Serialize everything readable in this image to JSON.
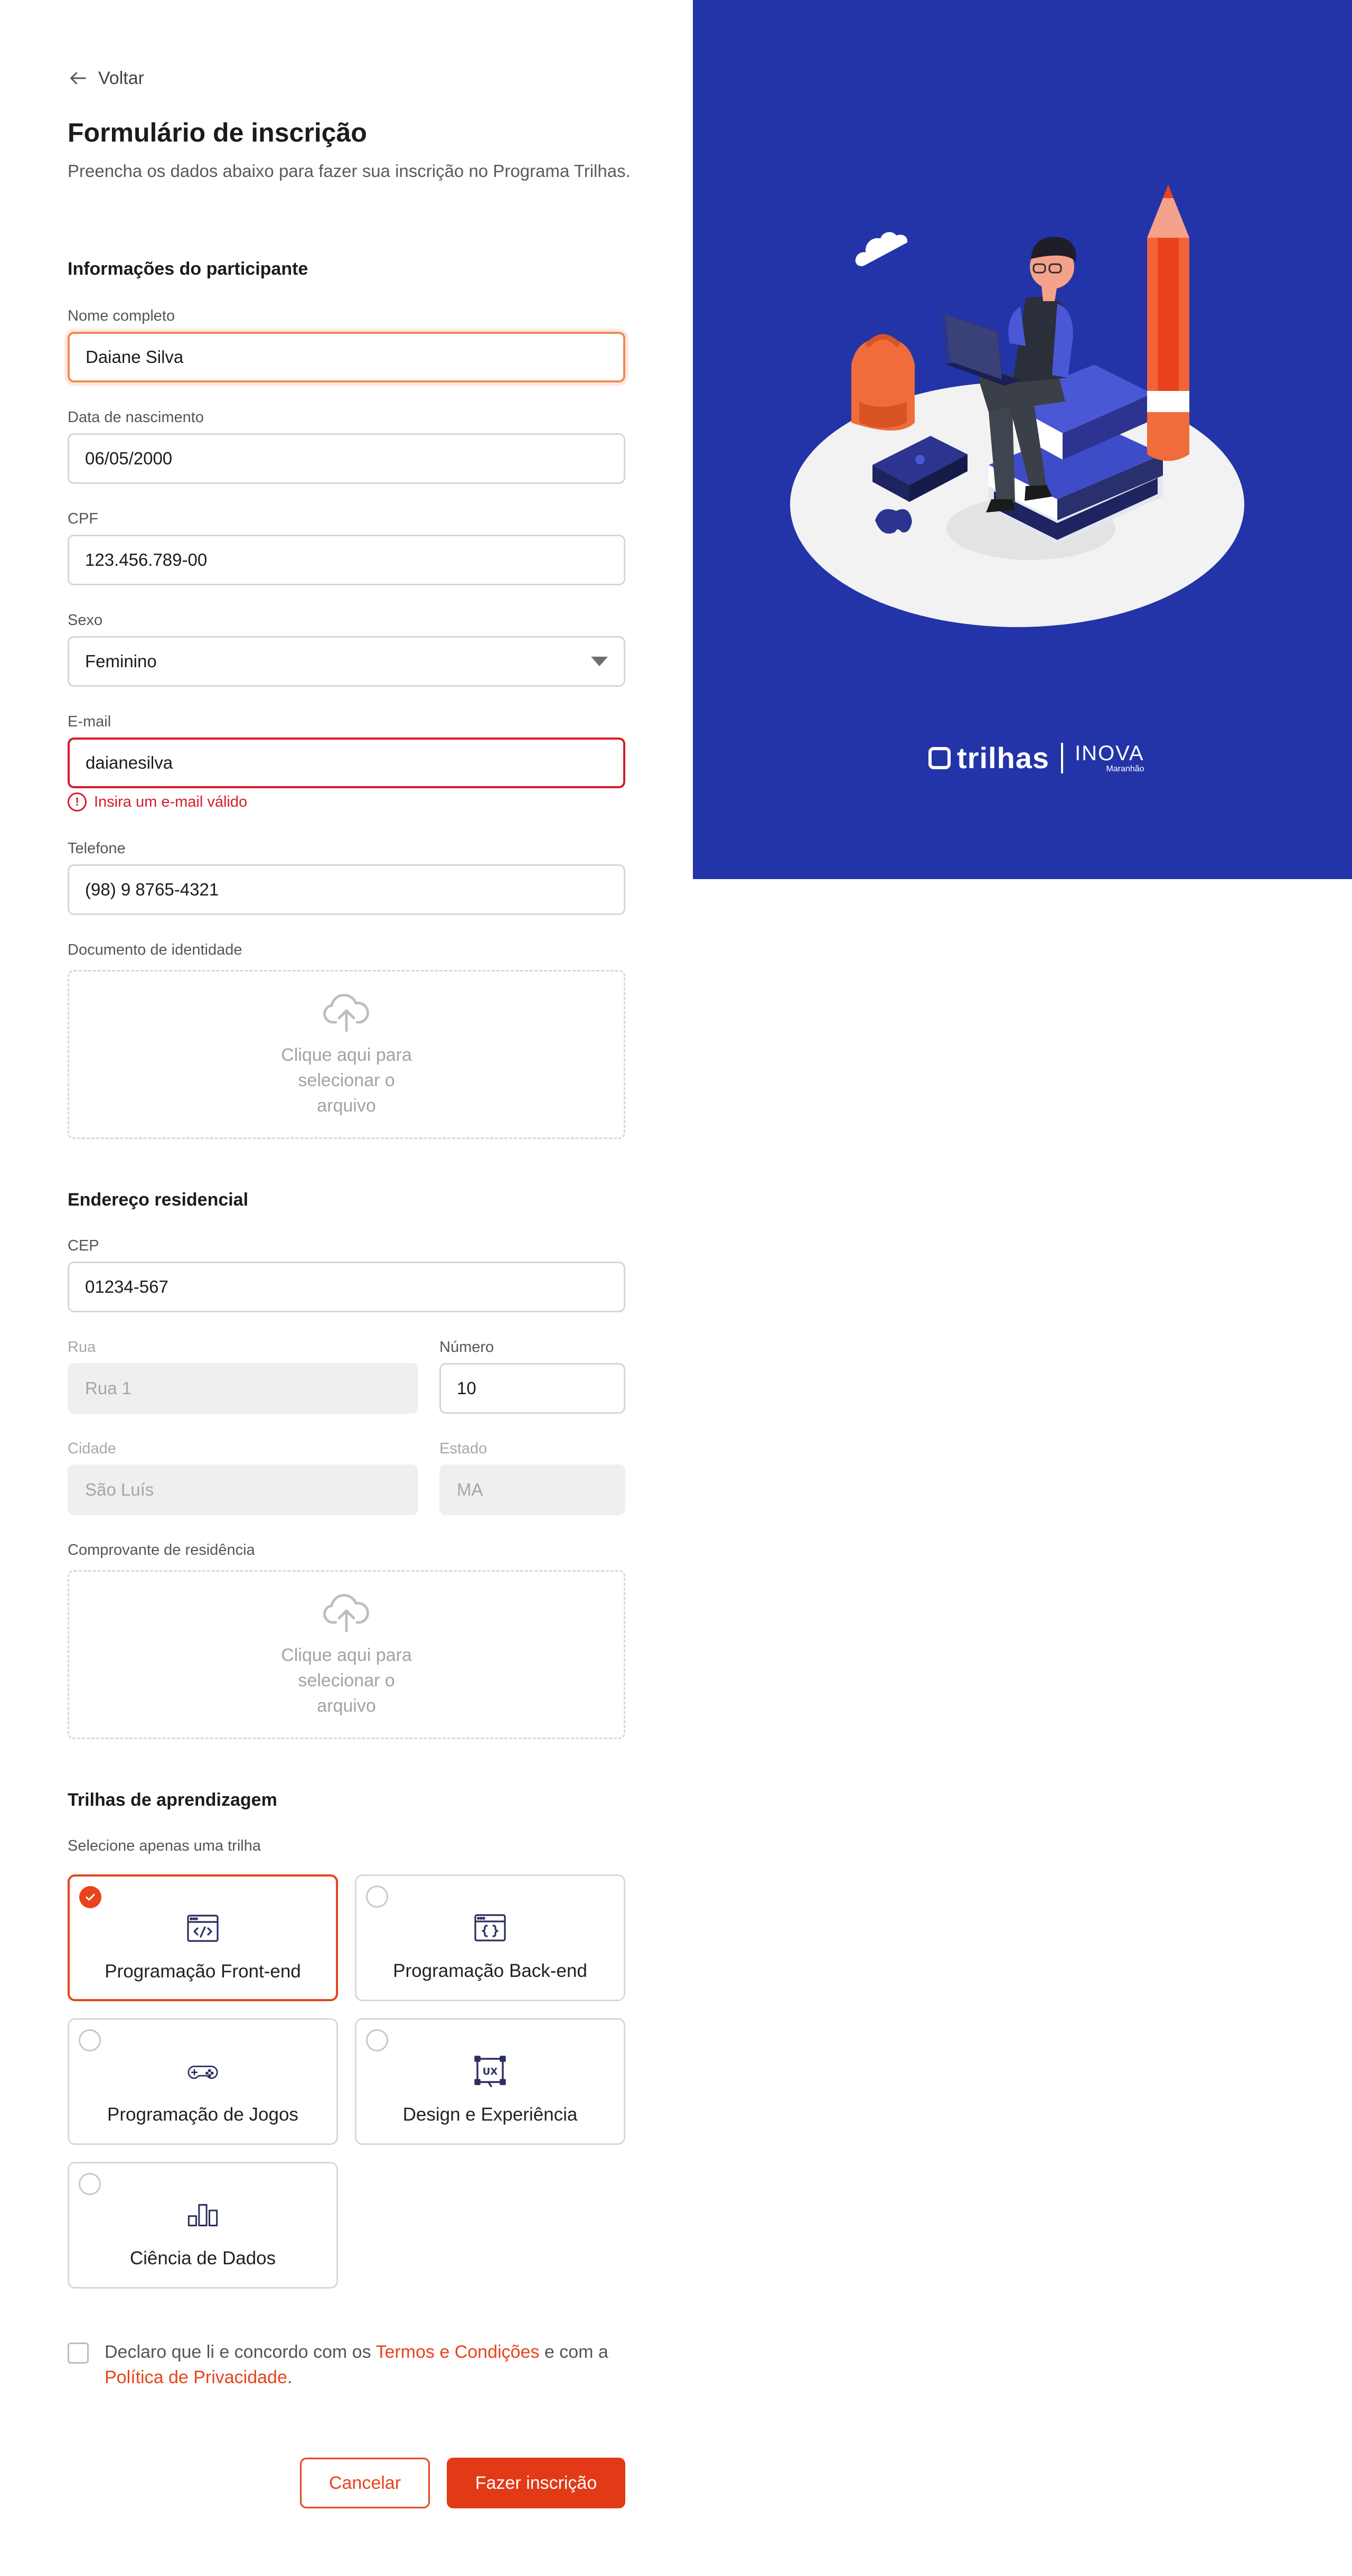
{
  "header": {
    "back_label": "Voltar",
    "title": "Formulário de inscrição",
    "subtitle": "Preencha os dados abaixo para fazer sua inscrição no Programa Trilhas."
  },
  "participant": {
    "section_title": "Informações do participante",
    "name": {
      "label": "Nome completo",
      "value": "Daiane Silva"
    },
    "birthdate": {
      "label": "Data de nascimento",
      "value": "06/05/2000"
    },
    "cpf": {
      "label": "CPF",
      "value": "123.456.789-00"
    },
    "sex": {
      "label": "Sexo",
      "value": "Feminino"
    },
    "email": {
      "label": "E-mail",
      "value": "daianesilva",
      "error": "Insira um e-mail válido"
    },
    "phone": {
      "label": "Telefone",
      "value": "(98) 9 8765-4321"
    },
    "id_document": {
      "label": "Documento de identidade",
      "upload_text": "Clique aqui para selecionar o arquivo"
    }
  },
  "address": {
    "section_title": "Endereço residencial",
    "cep": {
      "label": "CEP",
      "value": "01234-567"
    },
    "street": {
      "label": "Rua",
      "value": "Rua 1"
    },
    "number": {
      "label": "Número",
      "value": "10"
    },
    "city": {
      "label": "Cidade",
      "value": "São Luís"
    },
    "state": {
      "label": "Estado",
      "value": "MA"
    },
    "proof": {
      "label": "Comprovante de residência",
      "upload_text": "Clique aqui para selecionar o arquivo"
    }
  },
  "tracks": {
    "section_title": "Trilhas de aprendizagem",
    "hint": "Selecione apenas uma trilha",
    "items": [
      {
        "label": "Programação Front-end",
        "icon": "code-window-icon",
        "selected": true
      },
      {
        "label": "Programação Back-end",
        "icon": "braces-window-icon",
        "selected": false
      },
      {
        "label": "Programação de Jogos",
        "icon": "gamepad-icon",
        "selected": false
      },
      {
        "label": "Design e Experiência",
        "icon": "ux-icon",
        "selected": false
      },
      {
        "label": "Ciência de Dados",
        "icon": "bar-chart-icon",
        "selected": false
      }
    ]
  },
  "terms": {
    "prefix": "Declaro que li e concordo com os",
    "terms_link": "Termos e Condições",
    "middle": "e com a",
    "privacy_link": "Política de Privacidade",
    "suffix": "."
  },
  "actions": {
    "cancel_label": "Cancelar",
    "submit_label": "Fazer inscrição"
  },
  "brand": {
    "trilhas": "trilhas",
    "inova": "INOVA",
    "inova_sub": "Maranhão"
  },
  "colors": {
    "accent": "#e8431c",
    "panel_blue": "#2334a8",
    "error": "#d61c2b"
  }
}
